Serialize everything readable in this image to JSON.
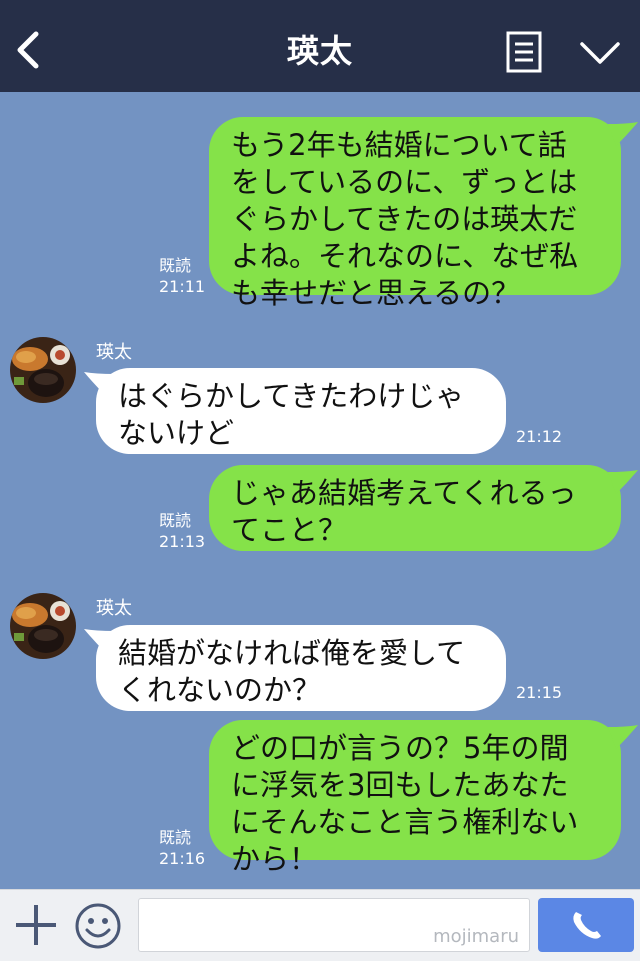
{
  "header": {
    "title": "瑛太",
    "back_icon": "chevron-left-icon",
    "menu_icon": "note-icon",
    "collapse_icon": "chevron-down-icon"
  },
  "messages": [
    {
      "type": "sent",
      "lines": [
        "もう2年も結婚について話",
        "をしているのに、ずっとは",
        "ぐらかしてきたのは瑛太だ",
        "よね。それなのに、なぜ私",
        "も幸せだと思えるの？"
      ],
      "read": "既読",
      "time": "21:11"
    },
    {
      "type": "recv",
      "sender": "瑛太",
      "lines": [
        "はぐらかしてきたわけじゃ",
        "ないけど"
      ],
      "time": "21:12"
    },
    {
      "type": "sent",
      "lines": [
        "じゃあ結婚考えてくれるっ",
        "てこと？"
      ],
      "read": "既読",
      "time": "21:13"
    },
    {
      "type": "recv",
      "sender": "瑛太",
      "lines": [
        "結婚がなければ俺を愛して",
        "くれないのか？"
      ],
      "time": "21:15"
    },
    {
      "type": "sent",
      "lines": [
        "どの口が言うの？5年の間",
        "に浮気を3回もしたあなた",
        "にそんなこと言う権利ない",
        "から！"
      ],
      "read": "既読",
      "time": "21:16"
    }
  ],
  "input": {
    "watermark": "mojimaru",
    "plus_icon": "plus-icon",
    "emoji_icon": "smiley-icon",
    "call_icon": "phone-icon"
  },
  "colors": {
    "header_bg": "#262f48",
    "chat_bg": "#7393c2",
    "sent_bubble": "#85e249",
    "recv_bubble": "#ffffff",
    "call_button": "#5b87e5"
  }
}
